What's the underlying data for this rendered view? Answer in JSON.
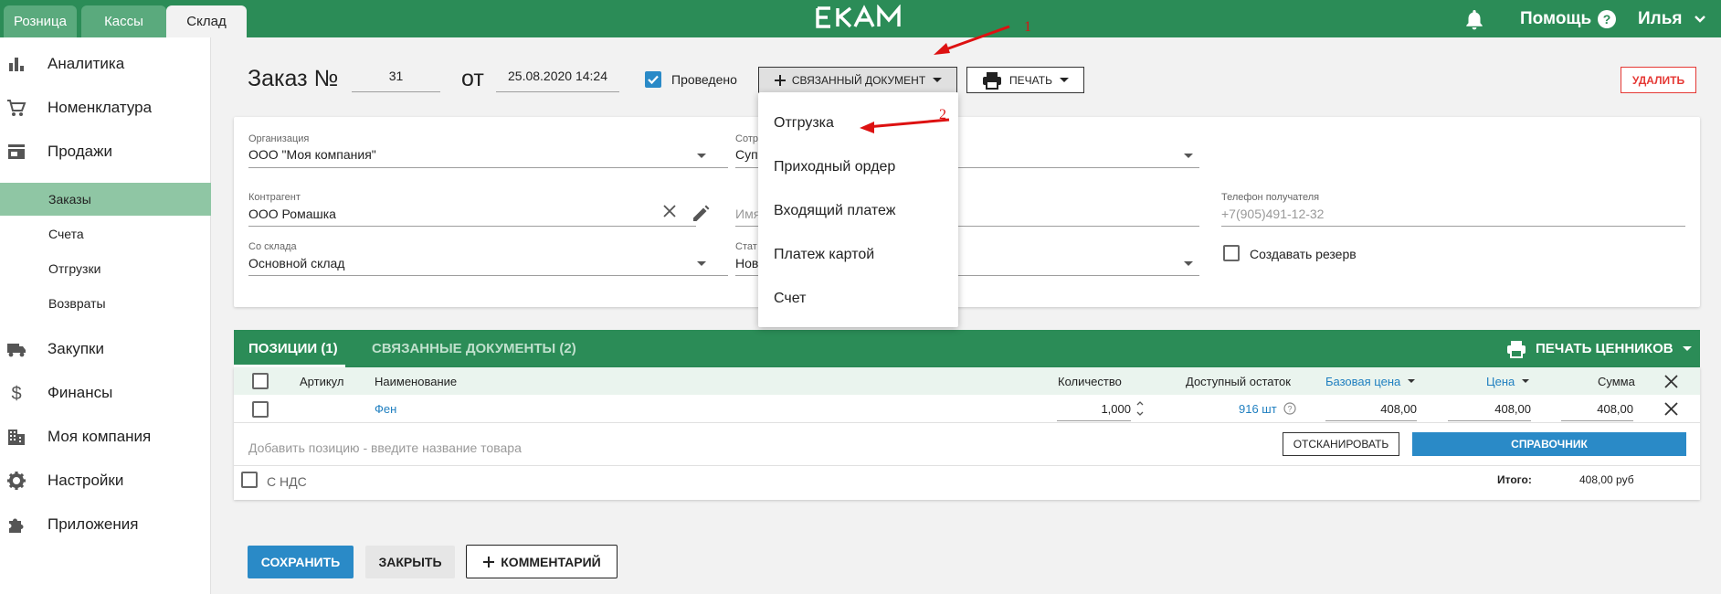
{
  "top_tabs": [
    "Розница",
    "Кассы",
    "Склад"
  ],
  "logo_text": "EKAM",
  "top_right": {
    "help": "Помощь",
    "user": "Илья"
  },
  "sidebar": {
    "items": [
      {
        "label": "Аналитика",
        "icon": "bar-chart-icon"
      },
      {
        "label": "Номенклатура",
        "icon": "cart-icon"
      },
      {
        "label": "Продажи",
        "icon": "store-icon"
      },
      {
        "label": "Закупки",
        "icon": "truck-icon"
      },
      {
        "label": "Финансы",
        "icon": "dollar-icon"
      },
      {
        "label": "Моя компания",
        "icon": "building-icon"
      },
      {
        "label": "Настройки",
        "icon": "gear-icon"
      },
      {
        "label": "Приложения",
        "icon": "puzzle-icon"
      }
    ],
    "subitems": [
      "Заказы",
      "Счета",
      "Отгрузки",
      "Возвраты"
    ]
  },
  "header": {
    "title": "Заказ №",
    "number": "31",
    "from_label": "от",
    "date": "25.08.2020 14:24",
    "posted_label": "Проведено",
    "linked_doc_button": "СВЯЗАННЫЙ ДОКУМЕНТ",
    "print_button": "ПЕЧАТЬ",
    "delete_button": "УДАЛИТЬ"
  },
  "menu": {
    "items": [
      "Отгрузка",
      "Приходный ордер",
      "Входящий платеж",
      "Платеж картой",
      "Счет"
    ]
  },
  "form": {
    "org_label": "Организация",
    "org_value": "ООО \"Моя компания\"",
    "employee_label_partial": "Сотр",
    "employee_value_partial": "Супе",
    "counterparty_label": "Контрагент",
    "counterparty_value": "ООО Ромашка",
    "recipient_name_partial": "Имя",
    "phone_label": "Телефон получателя",
    "phone_placeholder": "+7(905)491-12-32",
    "warehouse_label": "Со склада",
    "warehouse_value": "Основной склад",
    "status_label_partial": "Стат",
    "status_value_partial": "Нов",
    "reserve_label": "Создавать резерв"
  },
  "table": {
    "tabs": [
      "ПОЗИЦИИ (1)",
      "СВЯЗАННЫЕ ДОКУМЕНТЫ (2)"
    ],
    "print_tags_button": "ПЕЧАТЬ ЦЕННИКОВ",
    "columns": {
      "article": "Артикул",
      "name": "Наименование",
      "quantity": "Количество",
      "available": "Доступный остаток",
      "base_price": "Базовая цена",
      "price": "Цена",
      "sum": "Сумма"
    },
    "rows": [
      {
        "article": "",
        "name": "Фен",
        "quantity": "1,000",
        "available": "916 шт",
        "base_price": "408,00",
        "price": "408,00",
        "sum": "408,00"
      }
    ],
    "add_placeholder": "Добавить позицию - введите название товара",
    "scan_button": "ОТСКАНИРОВАТЬ",
    "catalog_button": "СПРАВОЧНИК",
    "vat_label": "С НДС",
    "total_label": "Итого:",
    "total_value": "408,00 руб"
  },
  "footer": {
    "save_button": "СОХРАНИТЬ",
    "close_button": "ЗАКРЫТЬ",
    "comment_button": "КОММЕНТАРИЙ"
  },
  "annotations": [
    "1",
    "2"
  ],
  "colors": {
    "brand_green": "#2b8c57",
    "accent_blue": "#2a8ac7",
    "link_blue": "#1f7fc0",
    "delete_red": "#e53935",
    "annotation_red": "#dd1111"
  }
}
